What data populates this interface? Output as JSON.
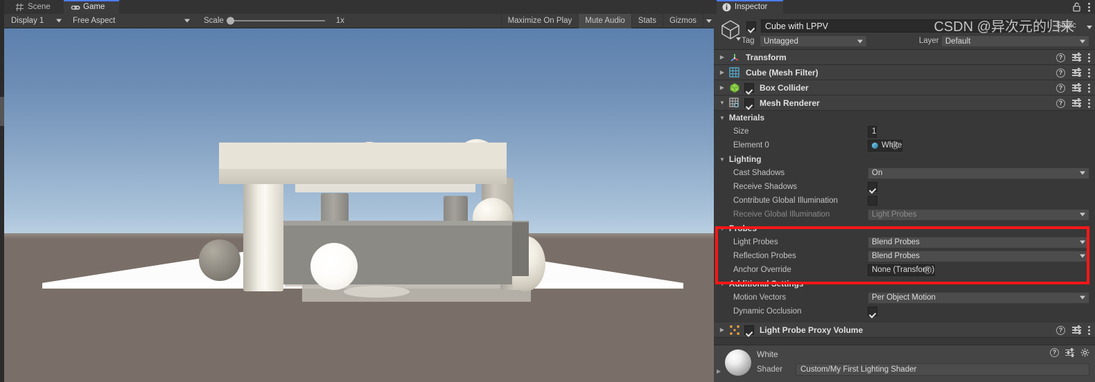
{
  "game_view": {
    "tabs": [
      {
        "label": "Scene",
        "icon": "grid-icon",
        "active": false
      },
      {
        "label": "Game",
        "icon": "gamepad-icon",
        "active": true
      }
    ],
    "toolbar": {
      "display": "Display 1",
      "aspect": "Free Aspect",
      "scale_label": "Scale",
      "scale_value": "1x",
      "maximize_on_play": "Maximize On Play",
      "mute_audio": "Mute Audio",
      "stats": "Stats",
      "gizmos": "Gizmos"
    }
  },
  "inspector": {
    "tab_label": "Inspector",
    "tab_icon": "info-icon",
    "lock_icon": "unlocked-padlock-icon",
    "menu_icon": "kebab-menu-icon",
    "object": {
      "name": "Cube with LPPV",
      "enabled": true,
      "static_label": "Static",
      "static_checked": false,
      "tag_label": "Tag",
      "tag_value": "Untagged",
      "layer_label": "Layer",
      "layer_value": "Default"
    },
    "components": [
      {
        "title": "Transform",
        "icon": "transform-axis-icon",
        "expanded": false,
        "has_toggle": false
      },
      {
        "title": "Cube (Mesh Filter)",
        "icon": "mesh-filter-icon",
        "expanded": false,
        "has_toggle": false
      },
      {
        "title": "Box Collider",
        "icon": "box-collider-icon",
        "expanded": false,
        "has_toggle": true,
        "enabled": true
      },
      {
        "title": "Mesh Renderer",
        "icon": "mesh-renderer-icon",
        "expanded": true,
        "has_toggle": true,
        "enabled": true
      }
    ],
    "mesh_renderer": {
      "materials": {
        "header": "Materials",
        "size_label": "Size",
        "size_value": "1",
        "element_label": "Element 0",
        "element_value": "White"
      },
      "lighting": {
        "header": "Lighting",
        "cast_shadows_label": "Cast Shadows",
        "cast_shadows_value": "On",
        "receive_shadows_label": "Receive Shadows",
        "receive_shadows_checked": true,
        "contribute_gi_label": "Contribute Global Illumination",
        "contribute_gi_checked": false,
        "receive_gi_label": "Receive Global Illumination",
        "receive_gi_value": "Light Probes",
        "receive_gi_disabled": true
      },
      "probes": {
        "header": "Probes",
        "highlighted": true,
        "highlight_color": "#fb1717",
        "light_probes_label": "Light Probes",
        "light_probes_value": "Blend Probes",
        "reflection_probes_label": "Reflection Probes",
        "reflection_probes_value": "Blend Probes",
        "anchor_override_label": "Anchor Override",
        "anchor_override_value": "None (Transform)"
      },
      "additional_settings": {
        "header": "Additional Settings",
        "motion_vectors_label": "Motion Vectors",
        "motion_vectors_value": "Per Object Motion",
        "dynamic_occlusion_label": "Dynamic Occlusion",
        "dynamic_occlusion_checked": true
      }
    },
    "lppv_component": {
      "title": "Light Probe Proxy Volume",
      "icon": "light-probe-proxy-volume-icon",
      "enabled": true,
      "expanded": false
    },
    "material_preview": {
      "name": "White",
      "shader_label": "Shader",
      "shader_value": "Custom/My First Lighting Shader"
    },
    "row_icons": {
      "help": "help-icon",
      "preset": "preset-sliders-icon",
      "menu": "kebab-menu-icon",
      "gear": "gear-icon"
    }
  },
  "watermark": "CSDN @异次元的归来"
}
